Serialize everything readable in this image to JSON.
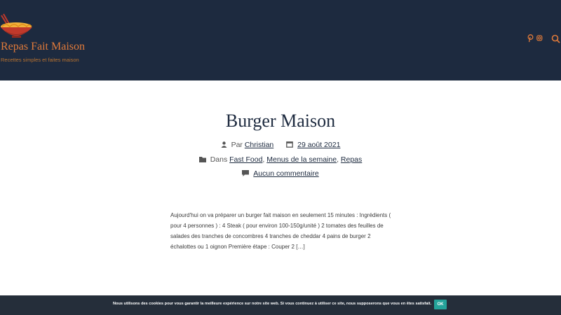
{
  "header": {
    "site_title": "Repas Fait Maison",
    "tagline": "Recettes simples et faites maison",
    "icons": [
      "pinterest-icon",
      "instagram-icon",
      "search-icon"
    ],
    "colors": {
      "background": "#1d2a3f",
      "accent": "#e07a3a"
    }
  },
  "post": {
    "title": "Burger Maison",
    "author_prefix": "Par",
    "author": "Christian",
    "date": "29 août 2021",
    "categories_prefix": "Dans",
    "categories": [
      "Fast Food",
      "Menus de la semaine",
      "Repas"
    ],
    "comments": "Aucun commentaire",
    "excerpt": "Aujourd'hui on va préparer un burger fait maison en seulement 15 minutes : Ingrédients ( pour 4 personnes ) : 4 Steak ( pour environ 100-150g/unité ) 2 tomates des feuilles de salades des tranches de concombres 4 tranches de cheddar 4 pains de burger 2 échalottes ou 1 oignon Première étape : Couper 2 […]"
  },
  "cookie_bar": {
    "message": "Nous utilisons des cookies pour vous garantir la meilleure expérience sur notre site web. Si vous continuez à utiliser ce site, nous supposerons que vous en êtes satisfait.",
    "ok_label": "OK",
    "colors": {
      "background": "#252e3a",
      "button": "#24a39a"
    }
  }
}
